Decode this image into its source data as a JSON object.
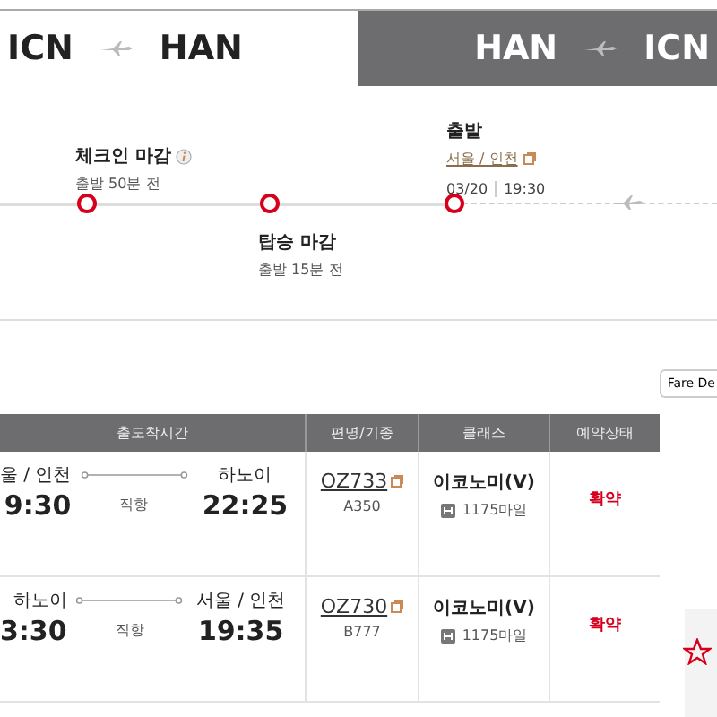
{
  "tabs": [
    {
      "from": "ICN",
      "to": "HAN",
      "selected": true
    },
    {
      "from": "HAN",
      "to": "ICN",
      "selected": false
    }
  ],
  "timeline": [
    {
      "kind": "above",
      "title": "체크인 마감",
      "info": true,
      "sub": "출발 50분 전"
    },
    {
      "kind": "below",
      "title": "탑승 마감",
      "info": false,
      "sub": "출발 15분 전"
    },
    {
      "kind": "departure",
      "title": "출발",
      "link": "서울 / 인천",
      "date": "03/20",
      "time": "19:30"
    }
  ],
  "fare_button": "Fare De",
  "table": {
    "columns": [
      "출도착시간",
      "편명/기종",
      "클래스",
      "예약상태"
    ],
    "rows": [
      {
        "dep_city": "울 / 인천",
        "dep_time": "9:30",
        "type": "직항",
        "arr_city": "하노이",
        "arr_time": "22:25",
        "flight": "OZ733",
        "aircraft": "A350",
        "class": "이코노미(V)",
        "miles": "1175마일",
        "status": "확약"
      },
      {
        "dep_city": "하노이",
        "dep_time": "3:30",
        "type": "직항",
        "arr_city": "서울 / 인천",
        "arr_time": "19:35",
        "flight": "OZ730",
        "aircraft": "B777",
        "class": "이코노미(V)",
        "miles": "1175마일",
        "status": "확약"
      }
    ]
  }
}
